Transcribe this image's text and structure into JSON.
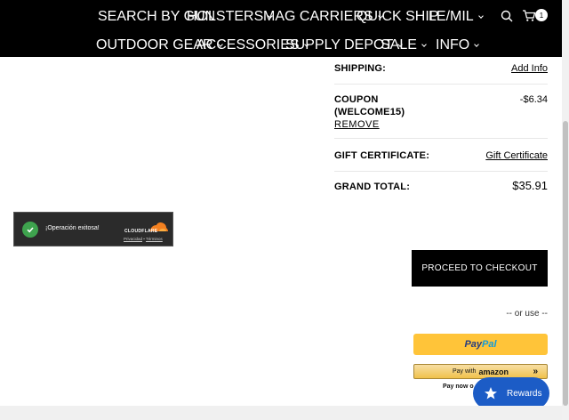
{
  "nav": {
    "row1": [
      "SEARCH BY GUN",
      "HOLSTERS",
      "MAG CARRIERS",
      "QUICK SHIP",
      "LE/MIL"
    ],
    "row2": [
      "OUTDOOR GEAR",
      "ACCESSORIES",
      "SUPPLY DEPOT",
      "SALE",
      "INFO"
    ],
    "cart_count": "1"
  },
  "summary": {
    "shipping_label": "SHIPPING:",
    "shipping_value": "Add Info",
    "coupon_label_1": "COUPON",
    "coupon_label_2": "(WELCOME15)",
    "coupon_value": "-$6.34",
    "coupon_remove": "REMOVE",
    "gift_label": "GIFT CERTIFICATE:",
    "gift_value": "Gift Certificate",
    "grand_label": "GRAND TOTAL:",
    "grand_value": "$35.91"
  },
  "checkout": {
    "button_label": "PROCEED TO CHECKOUT",
    "or_use": "-- or use --",
    "paypal_pay": "Pay",
    "paypal_pal": "Pal",
    "amazon_prefix": "Pay with",
    "amazon_brand": "amazon",
    "pay_now": "Pay now o"
  },
  "cloudflare": {
    "message": "¡Operación exitosa!",
    "brand": "CLOUDFLARE",
    "privacy": "Privacidad",
    "separator": "•",
    "terms": "Términos"
  },
  "rewards": {
    "label": "Rewards",
    "icon": "star-icon"
  },
  "colors": {
    "nav_bg": "#000000",
    "rewards_bg": "#1c5cc6",
    "paypal_bg": "#ffc439",
    "success": "#3ea34e"
  }
}
